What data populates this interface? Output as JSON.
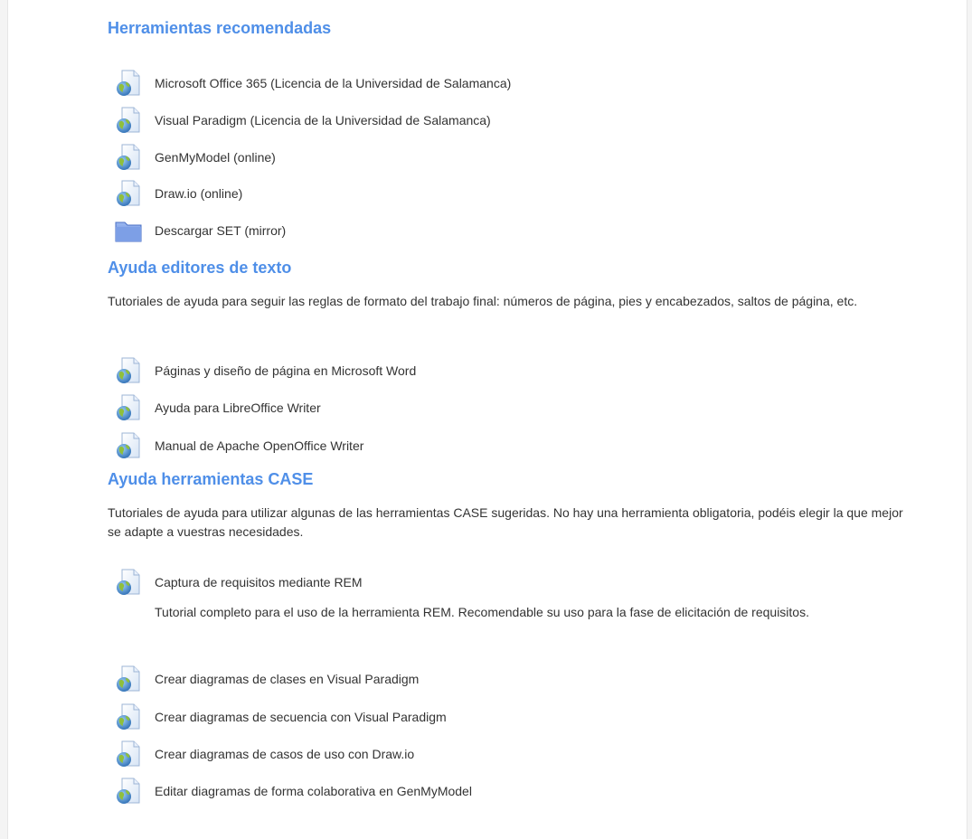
{
  "colors": {
    "heading": "#4f8fe8",
    "text": "#333333",
    "page_bg": "#ffffff",
    "outer_bg": "#f4f4f4"
  },
  "sections": [
    {
      "title": "Herramientas recomendadas",
      "summary": "",
      "activities": [
        {
          "label": "Microsoft Office 365 (Licencia de la Universidad de Salamanca)",
          "icon": "url-icon"
        },
        {
          "label": "Visual Paradigm (Licencia de la Universidad de Salamanca)",
          "icon": "url-icon"
        },
        {
          "label": "GenMyModel (online)",
          "icon": "url-icon"
        },
        {
          "label": "Draw.io (online)",
          "icon": "url-icon"
        },
        {
          "label": "Descargar SET (mirror)",
          "icon": "folder-icon"
        }
      ]
    },
    {
      "title": "Ayuda editores de texto",
      "summary": "Tutoriales de ayuda para seguir las reglas de formato del trabajo final: números de página, pies y encabezados, saltos de página, etc.",
      "activities": [
        {
          "label": "Páginas y diseño de página en Microsoft Word",
          "icon": "url-icon"
        },
        {
          "label": "Ayuda para LibreOffice Writer",
          "icon": "url-icon"
        },
        {
          "label": "Manual de Apache OpenOffice Writer",
          "icon": "url-icon"
        }
      ]
    },
    {
      "title": "Ayuda herramientas CASE",
      "summary": "Tutoriales de ayuda para utilizar algunas de las herramientas CASE sugeridas. No hay una herramienta obligatoria, podéis elegir la que mejor se adapte a vuestras necesidades.",
      "activities": [
        {
          "label": "Captura de requisitos mediante REM",
          "icon": "url-icon",
          "description": "Tutorial completo para el uso de la herramienta REM. Recomendable su uso para la fase de elicitación de requisitos."
        },
        {
          "label": "Crear diagramas de clases en Visual Paradigm",
          "icon": "url-icon"
        },
        {
          "label": "Crear diagramas de secuencia con Visual Paradigm",
          "icon": "url-icon"
        },
        {
          "label": "Crear diagramas de casos de uso con Draw.io",
          "icon": "url-icon"
        },
        {
          "label": "Editar diagramas de forma colaborativa en GenMyModel",
          "icon": "url-icon"
        }
      ]
    }
  ]
}
